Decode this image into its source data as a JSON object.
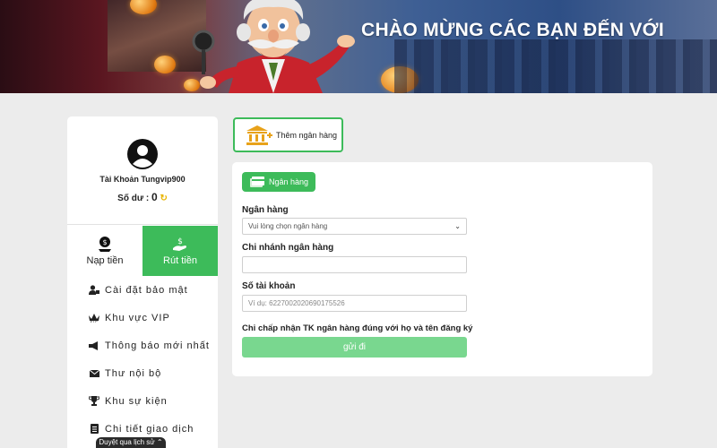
{
  "banner": {
    "title": "CHÀO MỪNG CÁC BẠN ĐẾN VỚI"
  },
  "profile": {
    "account": "Tài Khoản Tungvip900",
    "balance_label": "Số dư :",
    "balance_value": "0"
  },
  "tabs": [
    {
      "label": "Nạp tiền",
      "icon": "deposit-icon",
      "active": false
    },
    {
      "label": "Rút tiền",
      "icon": "withdraw-icon",
      "active": true
    }
  ],
  "menu": [
    {
      "label": "Cài đặt bảo mật",
      "icon": "user-lock-icon"
    },
    {
      "label": "Khu vực VIP",
      "icon": "crown-icon"
    },
    {
      "label": "Thông báo mới nhất",
      "icon": "megaphone-icon"
    },
    {
      "label": "Thư nội bộ",
      "icon": "envelope-icon"
    },
    {
      "label": "Khu sự kiện",
      "icon": "trophy-icon"
    },
    {
      "label": "Chi tiết giao dịch",
      "icon": "clipboard-icon"
    }
  ],
  "history_button": "Duyệt qua lịch sử",
  "add_bank": {
    "label": "Thêm ngân hàng"
  },
  "form": {
    "tab_label": "Ngân hàng",
    "bank_label": "Ngân hàng",
    "bank_placeholder": "Vui lòng chọn ngân hàng",
    "branch_label": "Chi nhánh ngân hàng",
    "branch_value": "",
    "account_label": "Số tài khoản",
    "account_placeholder": "Ví dụ: 6227002020690175526",
    "note": "Chỉ chấp nhận TK ngân hàng đúng với họ và tên đăng ký",
    "submit": "gửi đi"
  },
  "colors": {
    "accent": "#3dbb5a",
    "submit_disabled": "#79d78f",
    "background": "#ececec"
  }
}
